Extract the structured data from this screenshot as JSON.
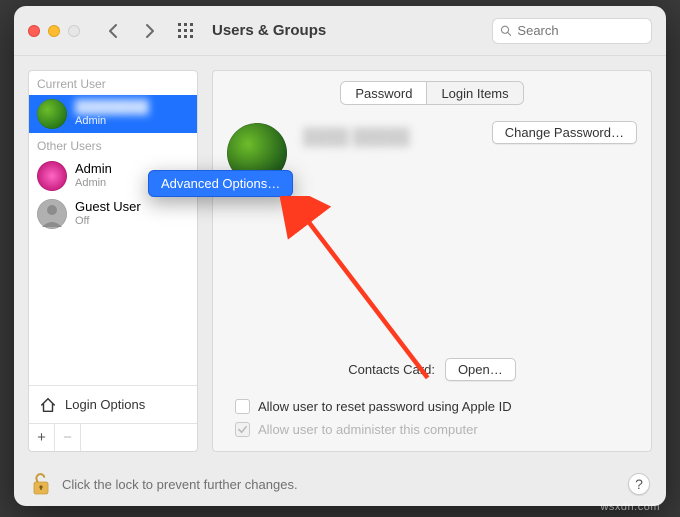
{
  "window": {
    "title": "Users & Groups",
    "search_placeholder": "Search"
  },
  "context_menu": {
    "advanced_options": "Advanced Options…"
  },
  "sidebar": {
    "current_user_label": "Current User",
    "other_users_label": "Other Users",
    "selected": {
      "name": "████████",
      "role": "Admin"
    },
    "others": [
      {
        "name": "Admin",
        "role": "Admin"
      },
      {
        "name": "Guest User",
        "role": "Off"
      }
    ],
    "login_options_label": "Login Options",
    "add_label": "+",
    "remove_label": "−"
  },
  "main": {
    "tabs": {
      "password": "Password",
      "login_items": "Login Items"
    },
    "display_name": "████ █████",
    "change_password": "Change Password…",
    "contacts_card_label": "Contacts Card:",
    "open_button": "Open…",
    "allow_reset_label": "Allow user to reset password using Apple ID",
    "allow_reset_checked": false,
    "allow_admin_label": "Allow user to administer this computer",
    "allow_admin_checked": true
  },
  "footer": {
    "lock_text": "Click the lock to prevent further changes.",
    "help_label": "?"
  },
  "watermark": "wsxdn.com"
}
